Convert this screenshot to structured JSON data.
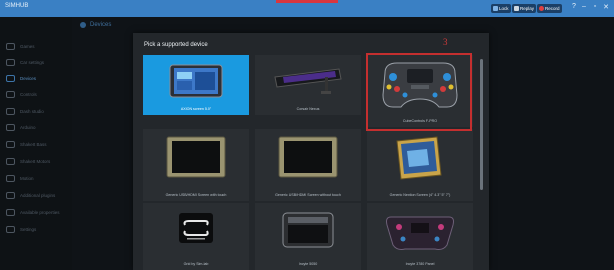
{
  "window": {
    "title": "SIMHUB",
    "buttons": [
      {
        "label": "Lock",
        "icon": "lock-icon",
        "color": "#1b3f66"
      },
      {
        "label": "Replay",
        "icon": "replay-icon",
        "color": "#1b3f66"
      },
      {
        "label": "Record",
        "icon": "record-icon",
        "color": "#1b3f66"
      }
    ],
    "controls": [
      "?",
      "–",
      "▫",
      "✕"
    ]
  },
  "page": {
    "section_title": "Devices"
  },
  "sidebar": {
    "items": [
      {
        "label": "Games",
        "icon": "gamepad-icon"
      },
      {
        "label": "Car settings",
        "icon": "car-icon"
      },
      {
        "label": "Devices",
        "icon": "devices-icon",
        "active": true
      },
      {
        "label": "Controls",
        "icon": "controls-icon"
      },
      {
        "label": "Dash studio",
        "icon": "dash-icon"
      },
      {
        "label": "Arduino",
        "icon": "arduino-icon"
      },
      {
        "label": "ShakeIt Bass",
        "icon": "bass-icon"
      },
      {
        "label": "ShakeIt Motors",
        "icon": "motors-icon"
      },
      {
        "label": "Motion",
        "icon": "motion-icon"
      },
      {
        "label": "Additional plugins",
        "icon": "plugins-icon"
      },
      {
        "label": "Available properties",
        "icon": "properties-icon"
      },
      {
        "label": "Settings",
        "icon": "settings-icon"
      }
    ]
  },
  "modal": {
    "title": "Pick a supported device",
    "step_number": "3",
    "devices": [
      {
        "caption": "AXION screen 5.0\"",
        "selected": true
      },
      {
        "caption": "Corsair Nexus"
      },
      {
        "caption": "CubeControls F-PRO",
        "highlighted": true
      },
      {
        "caption": "Generic USB/HDMI Screen with touch"
      },
      {
        "caption": "Generic USB/HDMI Screen without touch"
      },
      {
        "caption": "Generic Nextion Screen (4\" 4.3\" 5\" 7\")"
      },
      {
        "caption": "Grid by Sim-lab"
      },
      {
        "caption": "Incyte 5050"
      },
      {
        "caption": "Incyte 3780 Panel"
      }
    ]
  },
  "colors": {
    "accent": "#1a9ae0",
    "titlebar": "#3a80c4",
    "highlight": "#c42f2f"
  }
}
